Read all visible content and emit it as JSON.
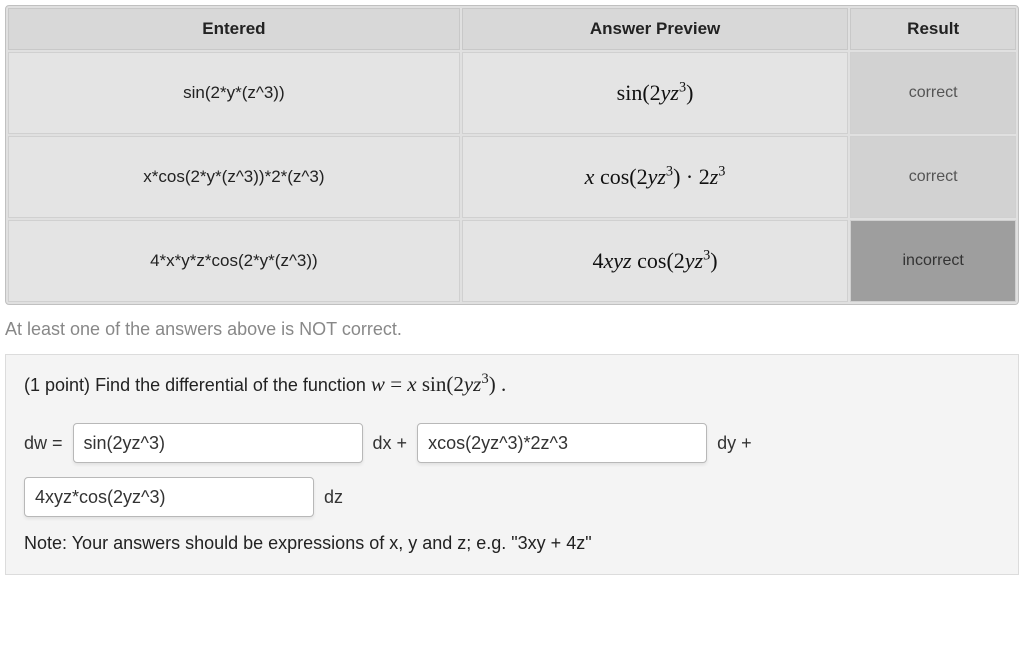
{
  "table": {
    "headers": {
      "entered": "Entered",
      "preview": "Answer Preview",
      "result": "Result"
    },
    "rows": [
      {
        "entered": "sin(2*y*(z^3))",
        "result": "correct",
        "result_class": "correct"
      },
      {
        "entered": "x*cos(2*y*(z^3))*2*(z^3)",
        "result": "correct",
        "result_class": "correct"
      },
      {
        "entered": "4*x*y*z*cos(2*y*(z^3))",
        "result": "incorrect",
        "result_class": "incorrect"
      }
    ]
  },
  "warning": "At least one of the answers above is NOT correct.",
  "problem": {
    "points": "(1 point)",
    "prompt_prefix": "Find the differential of the function",
    "labels": {
      "dw": "dw =",
      "dx": "dx +",
      "dy": "dy +",
      "dz": "dz"
    },
    "inputs": {
      "dx": "sin(2yz^3)",
      "dy": "xcos(2yz^3)*2z^3",
      "dz": "4xyz*cos(2yz^3)"
    },
    "note": "Note: Your answers should be expressions of x, y and z; e.g. \"3xy + 4z\""
  }
}
